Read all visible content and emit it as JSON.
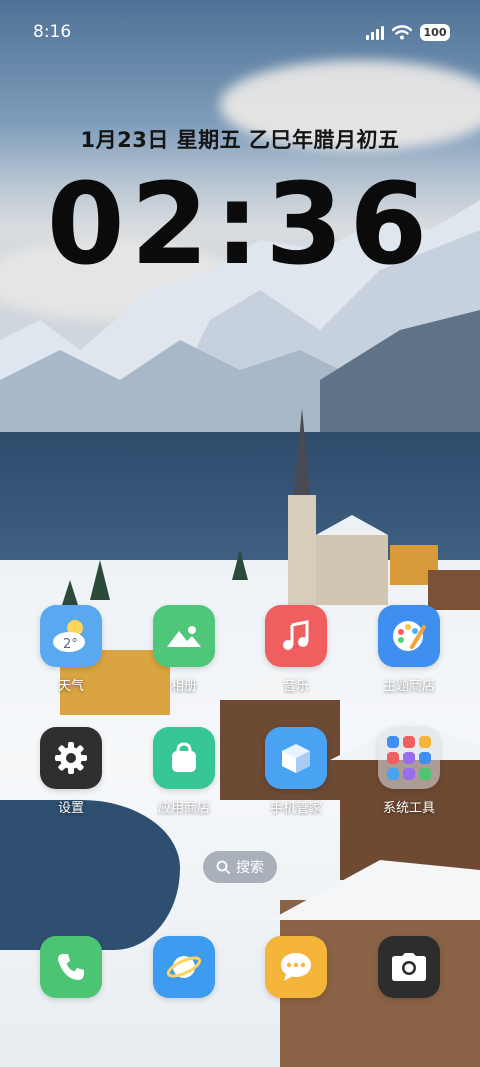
{
  "status_bar": {
    "time": "8:16",
    "battery": "100",
    "icons": [
      "signal-icon",
      "wifi-icon",
      "battery-icon"
    ]
  },
  "lock_clock": {
    "date": "1月23日 星期五 乙巳年腊月初五",
    "time": "02:36"
  },
  "apps": [
    {
      "label": "天气",
      "icon": "weather-icon",
      "color": "#5aa8f0",
      "badge": "2°"
    },
    {
      "label": "相册",
      "icon": "gallery-icon",
      "color": "#4fc77a"
    },
    {
      "label": "音乐",
      "icon": "music-icon",
      "color": "#ef5f5f"
    },
    {
      "label": "主题商店",
      "icon": "theme-store-icon",
      "color": "#3f8ff0"
    },
    {
      "label": "设置",
      "icon": "gear-icon",
      "color": "#2f2f2f"
    },
    {
      "label": "应用商店",
      "icon": "app-store-icon",
      "color": "#37c695"
    },
    {
      "label": "手机管家",
      "icon": "security-icon",
      "color": "#4aa2f2"
    },
    {
      "label": "系统工具",
      "icon": "folder-icon",
      "color": "rgba(220,225,232,0.55)"
    }
  ],
  "search": {
    "label": "搜索"
  },
  "dock": [
    {
      "icon": "phone-icon",
      "color": "#4cc474"
    },
    {
      "icon": "browser-icon",
      "color": "#3d9cf0"
    },
    {
      "icon": "messages-icon",
      "color": "#f5b43a"
    },
    {
      "icon": "camera-icon",
      "color": "#2d2d2d"
    }
  ]
}
